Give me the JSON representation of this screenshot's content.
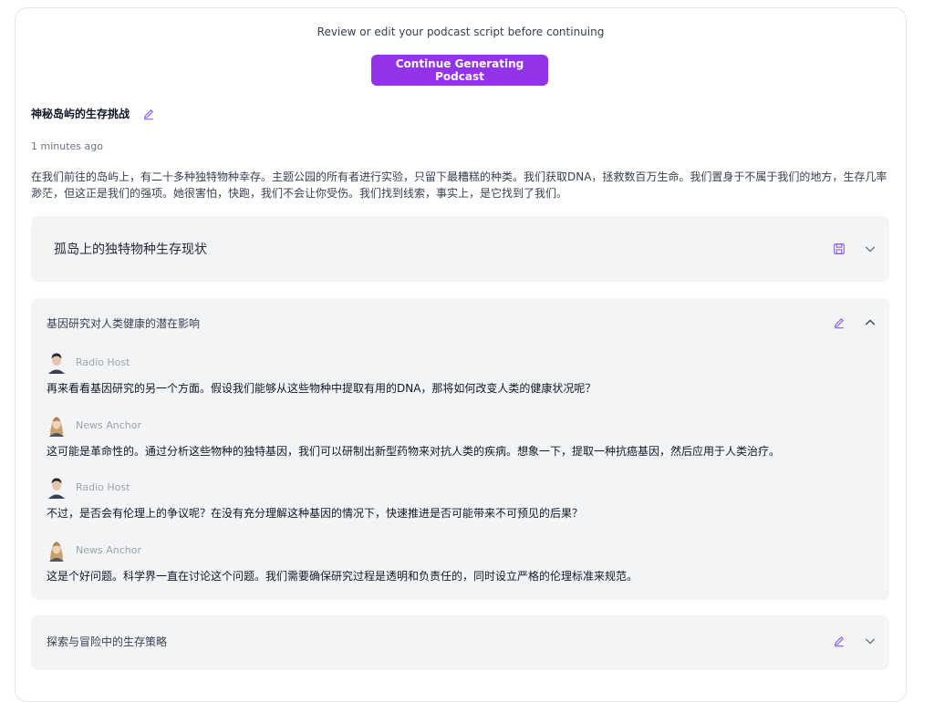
{
  "header": {
    "instruction": "Review or edit your podcast script before continuing",
    "continue_button": "Continue Generating Podcast"
  },
  "script": {
    "title": "神秘岛屿的生存挑战",
    "timestamp": "1 minutes ago",
    "description": "在我们前往的岛屿上，有二十多种独特物种幸存。主题公园的所有者进行实验，只留下最糟糕的种类。我们获取DNA，拯救数百万生命。我们置身于不属于我们的地方，生存几率渺茫，但这正是我们的强项。她很害怕，快跑，我们不会让你受伤。我们找到线索，事实上，是它找到了我们。"
  },
  "sections": [
    {
      "title": "孤岛上的独特物种生存现状",
      "state": "collapsed",
      "action_icon": "save-icon",
      "toggle_icon": "chevron-down-icon"
    },
    {
      "title": "基因研究对人类健康的潜在影响",
      "state": "expanded",
      "action_icon": "pencil-icon",
      "toggle_icon": "chevron-up-icon",
      "lines": [
        {
          "speaker": "Radio Host",
          "avatar": "male-avatar",
          "text": "再来看看基因研究的另一个方面。假设我们能够从这些物种中提取有用的DNA，那将如何改变人类的健康状况呢？"
        },
        {
          "speaker": "News Anchor",
          "avatar": "female-avatar",
          "text": "这可能是革命性的。通过分析这些物种的独特基因，我们可以研制出新型药物来对抗人类的疾病。想象一下，提取一种抗癌基因，然后应用于人类治疗。"
        },
        {
          "speaker": "Radio Host",
          "avatar": "male-avatar",
          "text": "不过，是否会有伦理上的争议呢？在没有充分理解这种基因的情况下，快速推进是否可能带来不可预见的后果？"
        },
        {
          "speaker": "News Anchor",
          "avatar": "female-avatar",
          "text": "这是个好问题。科学界一直在讨论这个问题。我们需要确保研究过程是透明和负责任的，同时设立严格的伦理标准来规范。"
        }
      ]
    },
    {
      "title": "探索与冒险中的生存策略",
      "state": "collapsed",
      "action_icon": "pencil-icon",
      "toggle_icon": "chevron-down-icon"
    }
  ],
  "colors": {
    "accent": "#9333ea",
    "icon_purple": "#8b5cf6",
    "section_bg": "#f3f4f6"
  }
}
